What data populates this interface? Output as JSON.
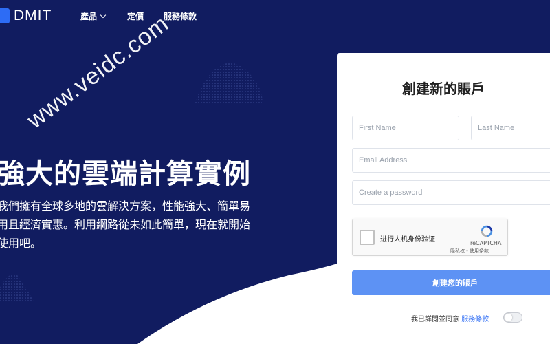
{
  "nav": {
    "logo": "DMIT",
    "items": [
      {
        "label": "產品"
      },
      {
        "label": "定價"
      },
      {
        "label": "服務條款"
      }
    ]
  },
  "watermark": "www.veidc.com",
  "hero": {
    "title": "強大的雲端計算實例",
    "description": "我們擁有全球多地的雲解決方案，性能強大、簡單易用且經濟實惠。利用網路從未如此簡單，現在就開始使用吧。"
  },
  "form": {
    "title": "創建新的賬戶",
    "first_name_placeholder": "First Name",
    "last_name_placeholder": "Last Name",
    "email_placeholder": "Email Address",
    "password_placeholder": "Create a password",
    "captcha_label": "进行人机身份验证",
    "captcha_brand": "reCAPTCHA",
    "captcha_links": "隐私权 - 使用条款",
    "submit_label": "創建您的賬戶",
    "agree_text": "我已詳閱並同意",
    "agree_link": "服務條款"
  },
  "colors": {
    "background": "#111c60",
    "accent": "#2d6cf5",
    "submit": "#5d92f4"
  }
}
